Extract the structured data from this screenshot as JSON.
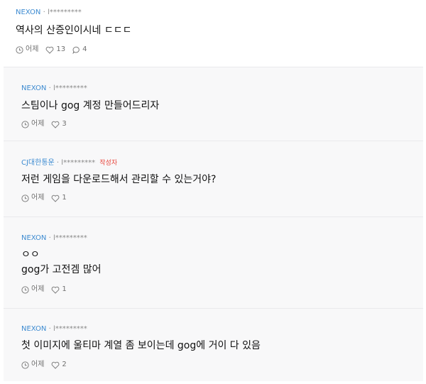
{
  "top_comment": {
    "author": "NEXON",
    "separator": "·",
    "masked_id": "l*********",
    "text": "역사의 산증인이시네 ㄷㄷㄷ",
    "time": "어제",
    "likes": "13",
    "replies": "4"
  },
  "replies": [
    {
      "author": "NEXON",
      "separator": "·",
      "masked_id": "l*********",
      "lines": [
        "스팀이나 gog 계정 만들어드리자"
      ],
      "time": "어제",
      "likes": "3"
    },
    {
      "author": "CJ대한통운",
      "separator": "·",
      "masked_id": "l*********",
      "badge": "작성자",
      "lines": [
        "저런 게임을 다운로드해서 관리할 수 있는거야?"
      ],
      "time": "어제",
      "likes": "1"
    },
    {
      "author": "NEXON",
      "separator": "·",
      "masked_id": "l*********",
      "lines": [
        "ㅇㅇ",
        "gog가 고전겜 많어"
      ],
      "time": "어제",
      "likes": "1"
    },
    {
      "author": "NEXON",
      "separator": "·",
      "masked_id": "l*********",
      "lines": [
        "첫 이미지에 울티마 계열 좀 보이는데 gog에 거이 다 있음"
      ],
      "time": "어제",
      "likes": "2"
    }
  ],
  "icons": {
    "time": "clock-icon",
    "like": "heart-icon",
    "reply": "speech-bubble-icon"
  },
  "colors": {
    "author": "#3d8bd1",
    "badge": "#e8433a",
    "reply_background": "#f8f8f9"
  }
}
